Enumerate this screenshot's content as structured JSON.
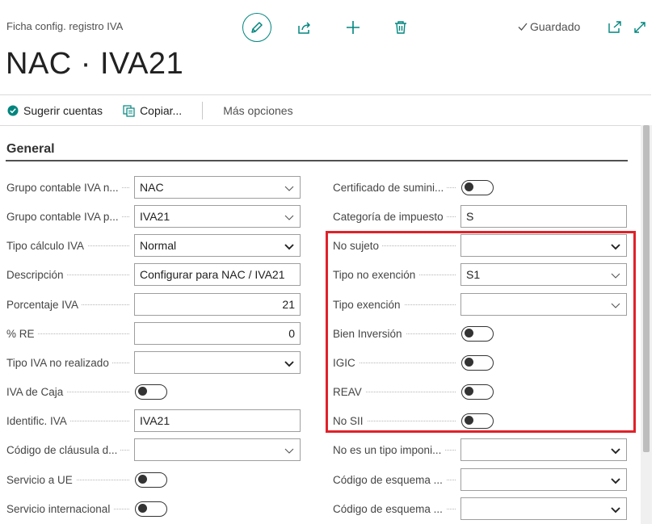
{
  "header": {
    "breadcrumb": "Ficha config. registro IVA",
    "page_title": "NAC · IVA21",
    "saved_label": "Guardado"
  },
  "actions": {
    "suggest_accounts": "Sugerir cuentas",
    "copy": "Copiar...",
    "more_options": "Más opciones"
  },
  "section": {
    "title": "General"
  },
  "left_fields": [
    {
      "label": "Grupo contable IVA n...",
      "type": "select",
      "value": "NAC",
      "chevron": "light"
    },
    {
      "label": "Grupo contable IVA p...",
      "type": "select",
      "value": "IVA21",
      "chevron": "light"
    },
    {
      "label": "Tipo cálculo IVA",
      "type": "select",
      "value": "Normal",
      "chevron": "bold"
    },
    {
      "label": "Descripción",
      "type": "text",
      "value": "Configurar para NAC / IVA21"
    },
    {
      "label": "Porcentaje IVA",
      "type": "number",
      "value": "21"
    },
    {
      "label": "% RE",
      "type": "number",
      "value": "0"
    },
    {
      "label": "Tipo IVA no realizado",
      "type": "select",
      "value": "",
      "chevron": "bold"
    },
    {
      "label": "IVA de Caja",
      "type": "toggle",
      "value": "off"
    },
    {
      "label": "Identific. IVA",
      "type": "text",
      "value": "IVA21"
    },
    {
      "label": "Código de cláusula d...",
      "type": "select",
      "value": "",
      "chevron": "light"
    },
    {
      "label": "Servicio a UE",
      "type": "toggle",
      "value": "off"
    },
    {
      "label": "Servicio internacional",
      "type": "toggle",
      "value": "off"
    }
  ],
  "right_fields": [
    {
      "label": "Certificado de sumini...",
      "type": "toggle",
      "value": "off"
    },
    {
      "label": "Categoría de impuesto",
      "type": "text",
      "value": "S"
    },
    {
      "label": "No sujeto",
      "type": "select",
      "value": "",
      "chevron": "bold"
    },
    {
      "label": "Tipo no exención",
      "type": "select",
      "value": "S1",
      "chevron": "light"
    },
    {
      "label": "Tipo exención",
      "type": "select",
      "value": "",
      "chevron": "light"
    },
    {
      "label": "Bien Inversión",
      "type": "toggle",
      "value": "off"
    },
    {
      "label": "IGIC",
      "type": "toggle",
      "value": "off"
    },
    {
      "label": "REAV",
      "type": "toggle",
      "value": "off"
    },
    {
      "label": "No SII",
      "type": "toggle",
      "value": "off"
    },
    {
      "label": "No es un tipo imponi...",
      "type": "select",
      "value": "",
      "chevron": "bold"
    },
    {
      "label": "Código de esquema ...",
      "type": "select",
      "value": "",
      "chevron": "bold"
    },
    {
      "label": "Código de esquema ...",
      "type": "select",
      "value": "",
      "chevron": "bold"
    }
  ],
  "colors": {
    "accent": "#00857e",
    "highlight": "#e02129"
  }
}
